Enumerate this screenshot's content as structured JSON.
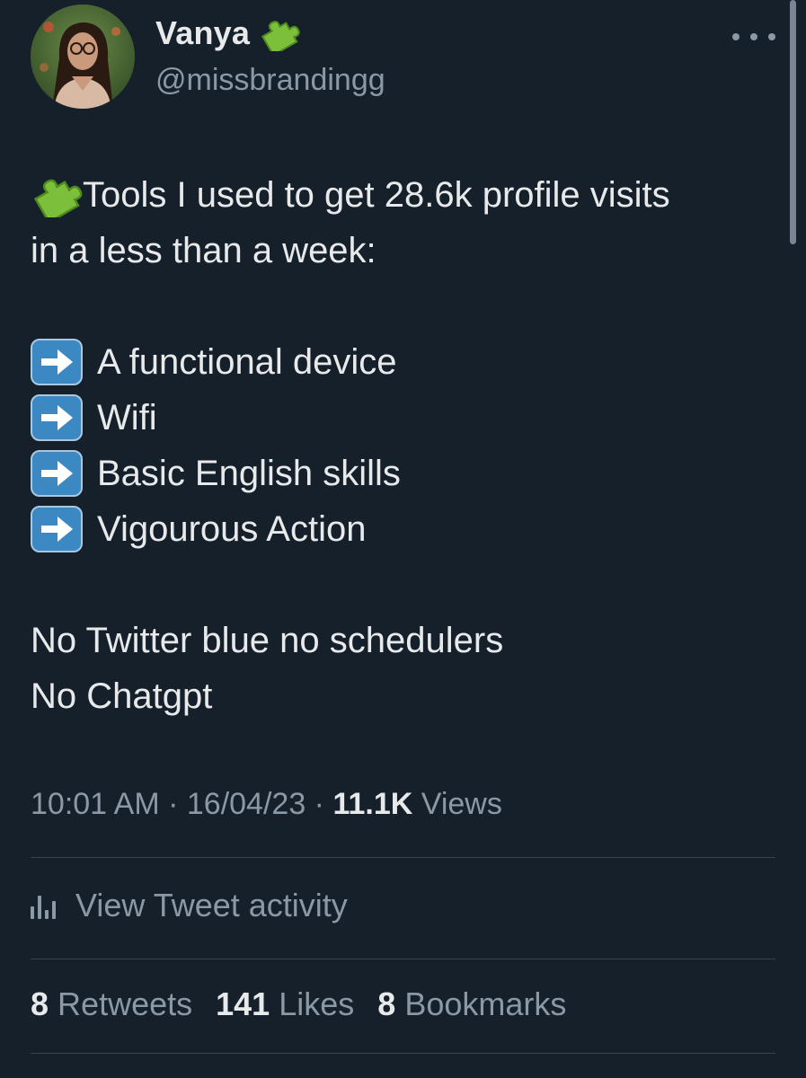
{
  "author": {
    "display_name": "Vanya",
    "name_emoji": "puzzle-piece-icon",
    "handle": "@missbrandingg"
  },
  "header": {
    "more_icon": "more-options-icon"
  },
  "tweet": {
    "intro_line_1": "Tools I used to get 28.6k profile visits",
    "intro_line_2": "in a less than a week:",
    "list_items": [
      "A functional device",
      "Wifi",
      "Basic English skills",
      "Vigourous Action"
    ],
    "closing_line_1": "No Twitter blue no schedulers",
    "closing_line_2": "No Chatgpt"
  },
  "meta": {
    "time": "10:01 AM",
    "separator": " · ",
    "date": "16/04/23",
    "views_count": "11.1K",
    "views_label": "Views"
  },
  "activity": {
    "label": "View Tweet activity",
    "icon": "analytics-bars-icon"
  },
  "stats": {
    "retweets_count": "8",
    "retweets_label": "Retweets",
    "likes_count": "141",
    "likes_label": "Likes",
    "bookmarks_count": "8",
    "bookmarks_label": "Bookmarks"
  },
  "colors": {
    "background": "#15202b",
    "text_primary": "#e7e9ea",
    "text_secondary": "#8b98a5",
    "divider": "#38444d",
    "puzzle_green": "#7cbf3a",
    "arrow_tile": "#3b88c3"
  }
}
